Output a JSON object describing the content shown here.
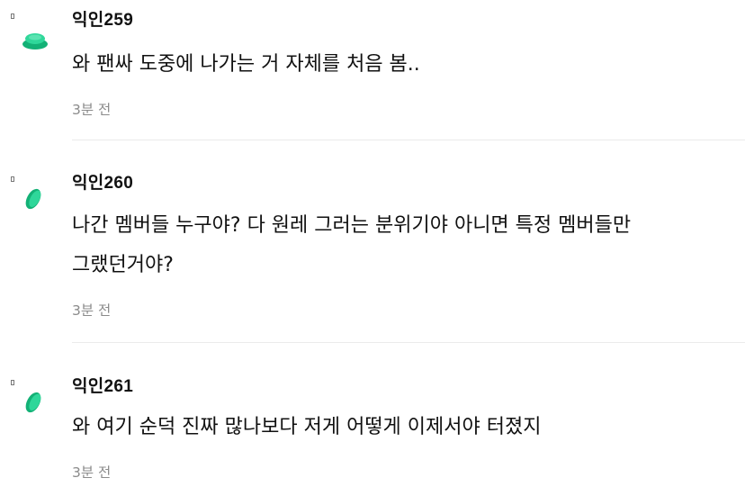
{
  "comments": [
    {
      "author": "익인259",
      "avatar_icon": "green-disc-icon",
      "text": "와 팬싸 도중에 나가는 거 자체를 처음 봄..",
      "time": "3분 전"
    },
    {
      "author": "익인260",
      "avatar_icon": "green-leaf-icon",
      "text": "나간 멤버들 누구야? 다 원레 그러는 분위기야 아니면 특정 멤버들만 그랬던거야?",
      "time": "3분 전"
    },
    {
      "author": "익인261",
      "avatar_icon": "green-leaf-icon",
      "text": "와 여기 순덕 진짜 많나보다 저게 어떻게 이제서야 터졌지",
      "time": "3분 전"
    }
  ],
  "colors": {
    "avatar_green": "#1ec98b",
    "avatar_green_dark": "#13b176",
    "time_gray": "#8b8b8b",
    "divider": "#ebebeb"
  }
}
